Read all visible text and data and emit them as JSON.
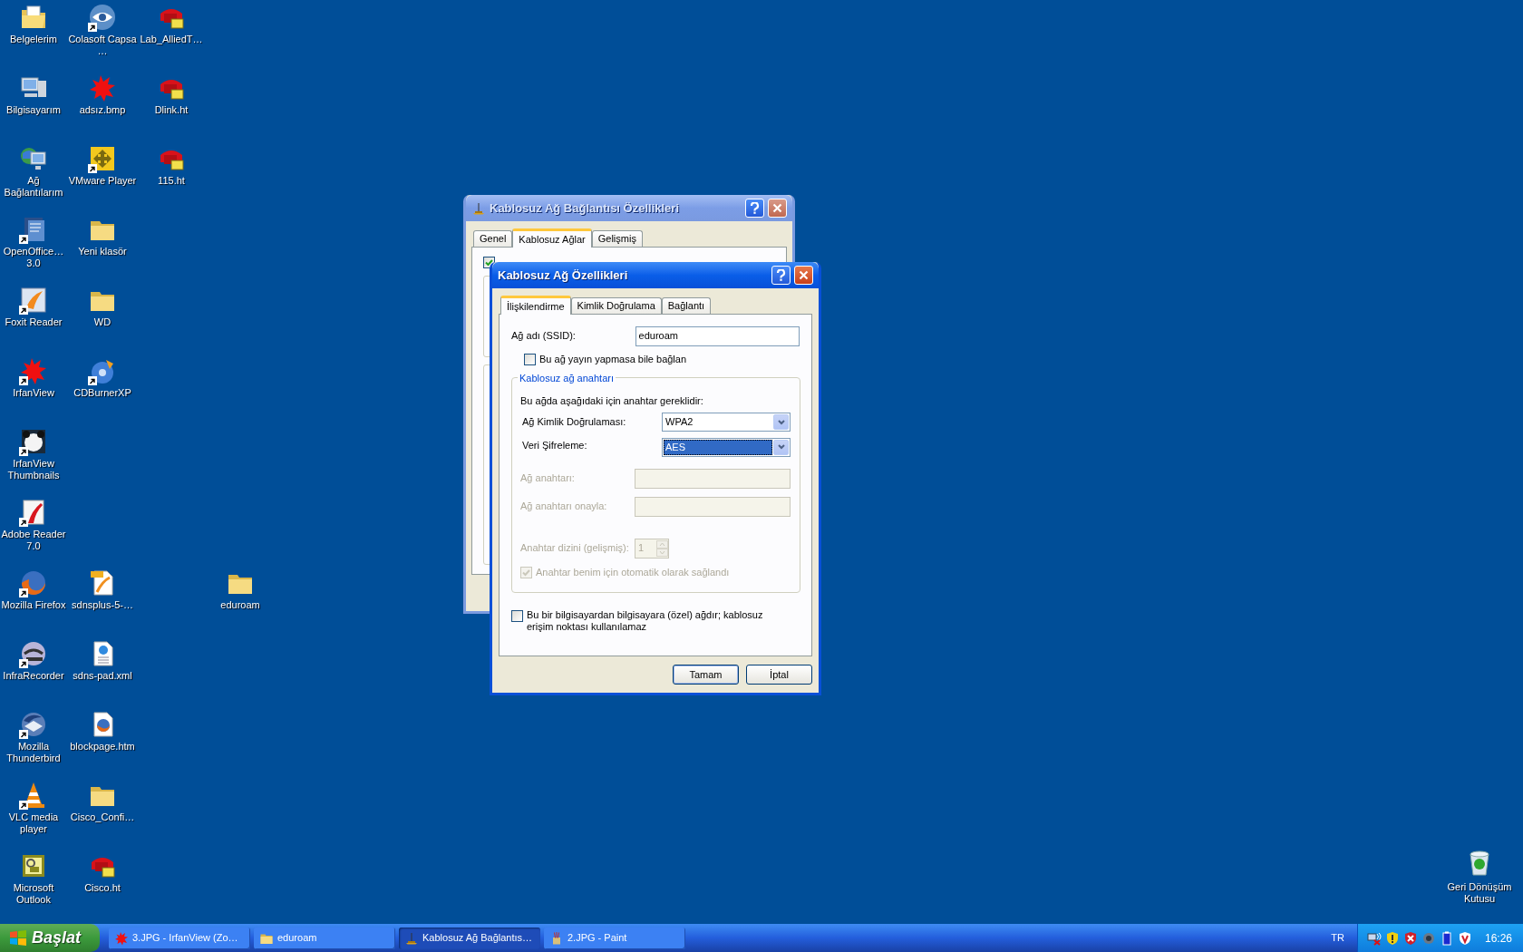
{
  "desktop_icons": [
    {
      "label": "Belgelerim",
      "kind": "documents",
      "shortcut": false
    },
    {
      "label": "Colasoft Capsa …",
      "kind": "eye",
      "shortcut": true
    },
    {
      "label": "Lab_AlliedT…",
      "kind": "phone",
      "shortcut": false
    },
    {
      "label": "Bilgisayarım",
      "kind": "computer",
      "shortcut": false
    },
    {
      "label": "adsız.bmp",
      "kind": "splat",
      "shortcut": false
    },
    {
      "label": "Dlink.ht",
      "kind": "phone",
      "shortcut": false
    },
    {
      "label": "Ağ Bağlantılarım",
      "kind": "network",
      "shortcut": false
    },
    {
      "label": "VMware Player",
      "kind": "vmware",
      "shortcut": true
    },
    {
      "label": "115.ht",
      "kind": "phone",
      "shortcut": false
    },
    {
      "label": "OpenOffice… 3.0",
      "kind": "openoffice",
      "shortcut": true
    },
    {
      "label": "Yeni klasör",
      "kind": "folder",
      "shortcut": false
    },
    {
      "label": "Foxit Reader",
      "kind": "foxit",
      "shortcut": true
    },
    {
      "label": "WD",
      "kind": "folder",
      "shortcut": false
    },
    {
      "label": "IrfanView",
      "kind": "splat",
      "shortcut": true
    },
    {
      "label": "CDBurnerXP",
      "kind": "cdburner",
      "shortcut": true
    },
    {
      "label": "IrfanView Thumbnails",
      "kind": "panda",
      "shortcut": true
    },
    {
      "label": "Adobe Reader 7.0",
      "kind": "adobe",
      "shortcut": true
    },
    {
      "label": "Mozilla Firefox",
      "kind": "firefox",
      "shortcut": true
    },
    {
      "label": "sdnsplus-5-…",
      "kind": "pdf",
      "shortcut": false
    },
    {
      "label": "eduroam",
      "kind": "folder",
      "shortcut": false
    },
    {
      "label": "InfraRecorder",
      "kind": "infra",
      "shortcut": true
    },
    {
      "label": "sdns-pad.xml",
      "kind": "xml",
      "shortcut": false
    },
    {
      "label": "Mozilla Thunderbird",
      "kind": "thunderbird",
      "shortcut": true
    },
    {
      "label": "blockpage.htm",
      "kind": "firefoxdoc",
      "shortcut": false
    },
    {
      "label": "VLC media player",
      "kind": "vlc",
      "shortcut": true
    },
    {
      "label": "Cisco_Confi…",
      "kind": "folder",
      "shortcut": false
    },
    {
      "label": "Microsoft Outlook",
      "kind": "outlook",
      "shortcut": false
    },
    {
      "label": "Cisco.ht",
      "kind": "phone",
      "shortcut": false
    }
  ],
  "recycle_bin": {
    "label": "Geri Dönüşüm Kutusu",
    "kind": "recycle"
  },
  "back_window": {
    "title": "Kablosuz Ağ Bağlantısı Özellikleri",
    "active": false,
    "tabs": [
      {
        "label": "Genel",
        "selected": false
      },
      {
        "label": "Kablosuz Ağlar",
        "selected": true
      },
      {
        "label": "Gelişmiş",
        "selected": false
      }
    ],
    "checkbox": {
      "checked": true
    }
  },
  "dialog": {
    "title": "Kablosuz Ağ Özellikleri",
    "active": true,
    "tabs": [
      {
        "label": "İlişkilendirme",
        "selected": true
      },
      {
        "label": "Kimlik Doğrulama",
        "selected": false
      },
      {
        "label": "Bağlantı",
        "selected": false
      }
    ],
    "ssid": {
      "label": "Ağ adı (SSID):",
      "value": "eduroam"
    },
    "broadcast_checkbox": {
      "label": "Bu ağ yayın yapmasa bile bağlan",
      "checked": false
    },
    "group": {
      "legend": "Kablosuz ağ anahtarı",
      "note": "Bu ağda aşağıdaki için anahtar gereklidir:",
      "authentication": {
        "label": "Ağ Kimlik Doğrulaması:",
        "value": "WPA2",
        "focused": false
      },
      "encryption": {
        "label": "Veri Şifreleme:",
        "value": "AES",
        "focused": true
      },
      "network_key": {
        "label": "Ağ anahtarı:",
        "disabled": true
      },
      "confirm_key": {
        "label": "Ağ anahtarı onayla:",
        "disabled": true
      },
      "key_index": {
        "label": "Anahtar dizini (gelişmiş):",
        "value": "1",
        "disabled": true
      },
      "auto_key": {
        "label": "Anahtar benim için otomatik olarak sağlandı",
        "checked": true,
        "disabled": true
      }
    },
    "adhoc_checkbox": {
      "label": "Bu bir bilgisayardan bilgisayara (özel) ağdır; kablosuz erişim noktası kullanılamaz",
      "checked": false
    },
    "buttons": [
      {
        "label": "Tamam",
        "default": true
      },
      {
        "label": "İptal",
        "default": false
      }
    ]
  },
  "taskbar": {
    "start": "Başlat",
    "tasks": [
      {
        "label": "3.JPG - IrfanView (Zo…",
        "kind": "splat",
        "selected": false
      },
      {
        "label": "eduroam",
        "kind": "folder",
        "selected": false
      },
      {
        "label": "Kablosuz Ağ Bağlantıs…",
        "kind": "antenna",
        "selected": true
      },
      {
        "label": "2.JPG - Paint",
        "kind": "paint",
        "selected": false
      }
    ],
    "language": "TR",
    "tray_icons": [
      {
        "kind": "network-error"
      },
      {
        "kind": "shield-warning"
      },
      {
        "kind": "shield-alert"
      },
      {
        "kind": "device"
      },
      {
        "kind": "battery"
      },
      {
        "kind": "shield-v"
      }
    ],
    "clock": "16:26"
  }
}
